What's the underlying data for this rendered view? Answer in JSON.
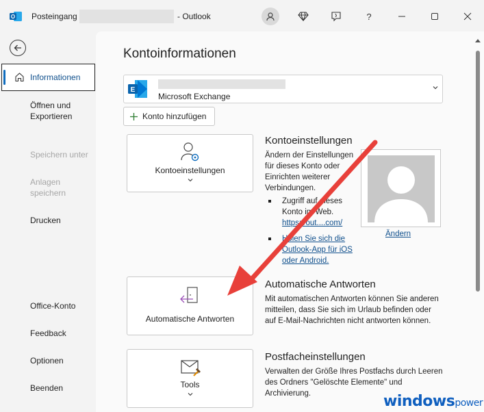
{
  "titlebar": {
    "folder": "Posteingang",
    "separator": "-",
    "app": "Outlook",
    "help": "?"
  },
  "sidebar": {
    "items": [
      {
        "label": "Informationen",
        "state": "selected"
      },
      {
        "label": "Öffnen und Exportieren",
        "state": "enabled"
      },
      {
        "label": "Speichern unter",
        "state": "disabled"
      },
      {
        "label": "Anlagen speichern",
        "state": "disabled"
      },
      {
        "label": "Drucken",
        "state": "enabled"
      },
      {
        "label": "Office-Konto",
        "state": "enabled"
      },
      {
        "label": "Feedback",
        "state": "enabled"
      },
      {
        "label": "Optionen",
        "state": "enabled"
      },
      {
        "label": "Beenden",
        "state": "enabled"
      }
    ]
  },
  "main": {
    "title": "Kontoinformationen",
    "account": {
      "type": "Microsoft Exchange"
    },
    "add_account_label": "Konto hinzufügen",
    "sections": {
      "account_settings": {
        "tile_label": "Kontoeinstellungen",
        "title": "Kontoeinstellungen",
        "description": "Ändern der Einstellungen für dieses Konto oder Einrichten weiterer Verbindungen.",
        "bullet1_text": "Zugriff auf dieses Konto im Web.",
        "bullet1_link": "https://out....com/",
        "bullet2_link": "Holen Sie sich die Outlook-App für iOS oder Android.",
        "change_photo": "Ändern"
      },
      "auto_replies": {
        "tile_label": "Automatische Antworten",
        "title": "Automatische Antworten",
        "description": "Mit automatischen Antworten können Sie anderen mitteilen, dass Sie sich im Urlaub befinden oder auf E-Mail-Nachrichten nicht antworten können."
      },
      "mailbox": {
        "tile_label": "Tools",
        "title": "Postfacheinstellungen",
        "description": "Verwalten der Größe Ihres Postfachs durch Leeren des Ordners \"Gelöschte Elemente\" und Archivierung."
      }
    }
  },
  "watermark": {
    "brand": "windows",
    "suffix": "power"
  },
  "colors": {
    "accent": "#0f6cbd",
    "link": "#0f4f8c",
    "arrow": "#e8403a"
  }
}
